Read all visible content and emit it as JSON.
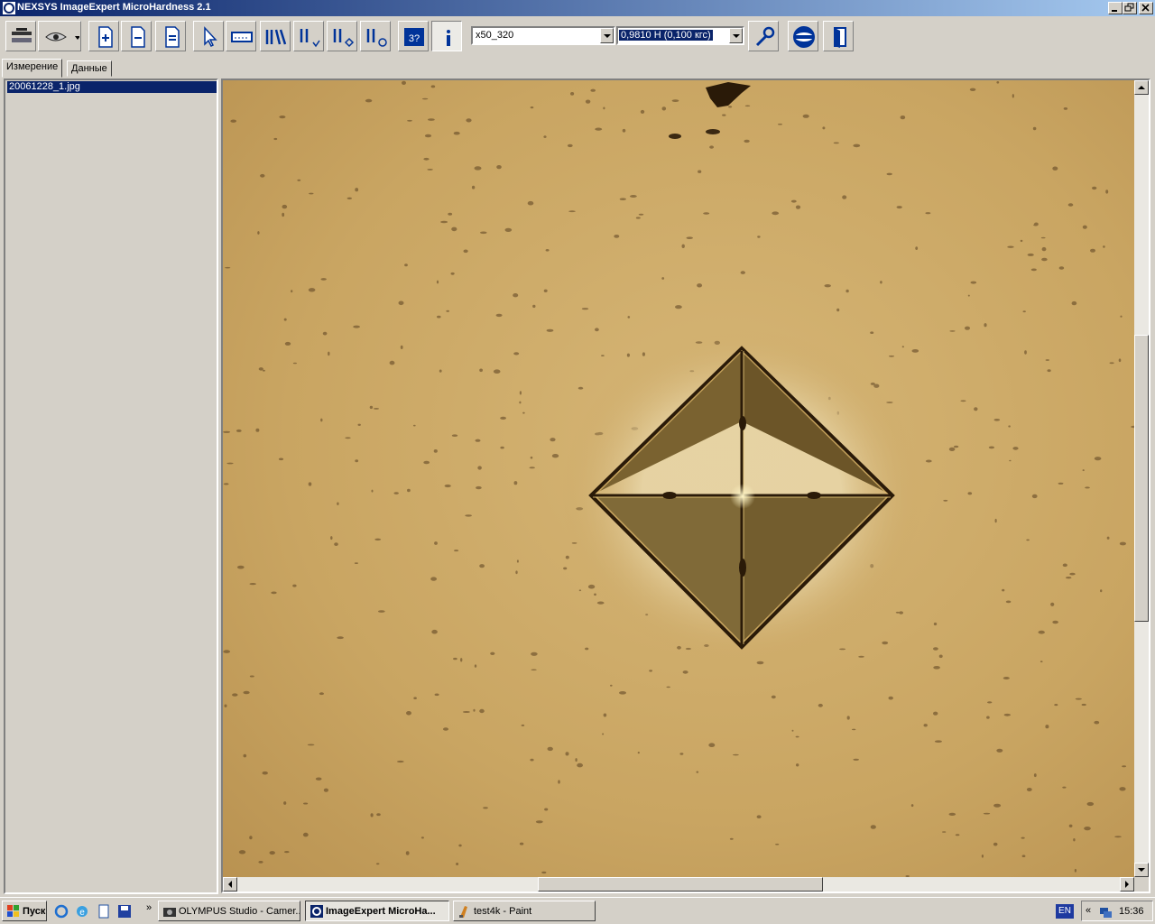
{
  "window": {
    "title": "NEXSYS ImageExpert MicroHardness 2.1"
  },
  "toolbar": {
    "objective": "x50_320",
    "load": "0,9810 Н  (0,100 кгс)",
    "icons": [
      "stage-icon",
      "eye-icon",
      "new-file-icon",
      "open-file-icon",
      "save-file-icon",
      "pointer-icon",
      "ruler-icon",
      "measure-multi-icon",
      "measure-down-icon",
      "measure-diamond-icon",
      "measure-circle-icon",
      "calibrate-icon",
      "info-icon",
      "wrench-icon",
      "lens-icon",
      "exit-icon"
    ]
  },
  "tabs": [
    {
      "label": "Измерение"
    },
    {
      "label": "Данные"
    }
  ],
  "files": [
    {
      "name": "20061228_1.jpg"
    }
  ],
  "taskbar": {
    "start": "Пуск",
    "apps": [
      {
        "label": "OLYMPUS Studio - Camer..."
      },
      {
        "label": "ImageExpert MicroHa..."
      },
      {
        "label": "test4k - Paint"
      }
    ],
    "language": "EN",
    "clock": "15:36"
  },
  "colors": {
    "titlebar_start": "#0a246a",
    "titlebar_end": "#a6caf0",
    "selection": "#0a246a",
    "specimen_surface": "#c9a562"
  }
}
